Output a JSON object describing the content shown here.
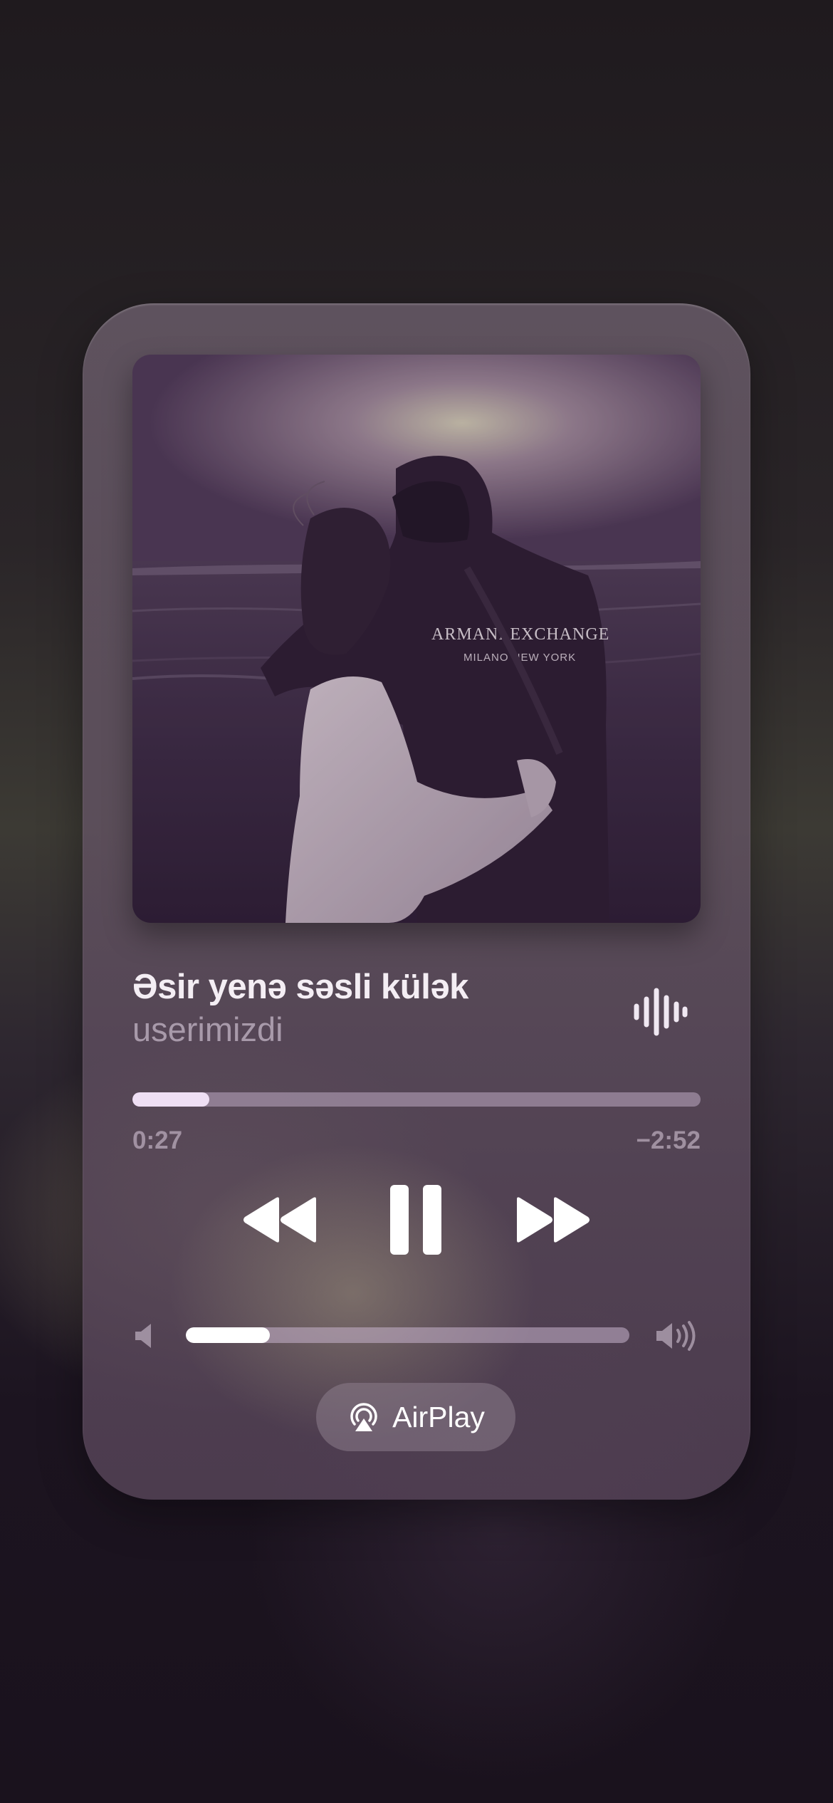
{
  "track": {
    "title": "Əsir yenə səsli külək",
    "artist": "userimizdi"
  },
  "playback": {
    "elapsed": "0:27",
    "remaining": "−2:52",
    "progress_fraction": 0.135,
    "state": "playing"
  },
  "volume": {
    "level_fraction": 0.19
  },
  "airplay": {
    "label": "AirPlay"
  },
  "artwork": {
    "hoodie_text_line1": "ARMANI EXCHANGE",
    "hoodie_text_line2": "MILANO NEW YORK"
  },
  "icons": {
    "wave": "waveform-icon",
    "rewind": "rewind-icon",
    "pause": "pause-icon",
    "forward": "fast-forward-icon",
    "volume_low": "speaker-low-icon",
    "volume_high": "speaker-high-icon",
    "airplay": "airplay-icon"
  },
  "colors": {
    "accent": "#efdff4",
    "card": "#6e606e"
  }
}
